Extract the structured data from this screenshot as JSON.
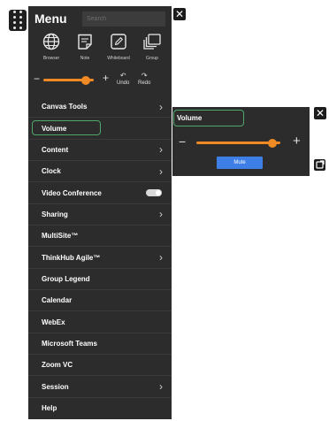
{
  "menu": {
    "title": "Menu",
    "search_placeholder": "Search",
    "tools": [
      {
        "label": "Browser",
        "icon": "globe-icon"
      },
      {
        "label": "Note",
        "icon": "note-icon"
      },
      {
        "label": "Whiteboard",
        "icon": "whiteboard-icon"
      },
      {
        "label": "Group",
        "icon": "group-icon"
      }
    ],
    "volume_slider": {
      "minus": "−",
      "plus": "+",
      "level": 0.85
    },
    "undo_label": "Undo",
    "redo_label": "Redo",
    "items": [
      {
        "label": "Canvas Tools",
        "chevron": true
      },
      {
        "label": "Volume",
        "selected": true
      },
      {
        "label": "Content",
        "chevron": true
      },
      {
        "label": "Clock",
        "chevron": true
      },
      {
        "label": "Video Conference",
        "toggle": true
      },
      {
        "label": "Sharing",
        "chevron": true
      },
      {
        "label": "MultiSite™"
      },
      {
        "label": "ThinkHub Agile™",
        "chevron": true
      },
      {
        "label": "Group Legend"
      },
      {
        "label": "Calendar"
      },
      {
        "label": "WebEx"
      },
      {
        "label": "Microsoft Teams"
      },
      {
        "label": "Zoom VC"
      },
      {
        "label": "Session",
        "chevron": true
      },
      {
        "label": "Help"
      }
    ],
    "chevron_glyph": "›"
  },
  "volume_panel": {
    "title": "Volume",
    "minus": "−",
    "plus": "+",
    "level": 0.9,
    "mute_label": "Mute"
  },
  "close_glyph": "✕",
  "colors": {
    "panel_bg": "#2c2c2c",
    "accent_orange": "#f08a24",
    "selection_green": "#4fa86a",
    "mute_blue": "#3d7fe6"
  }
}
